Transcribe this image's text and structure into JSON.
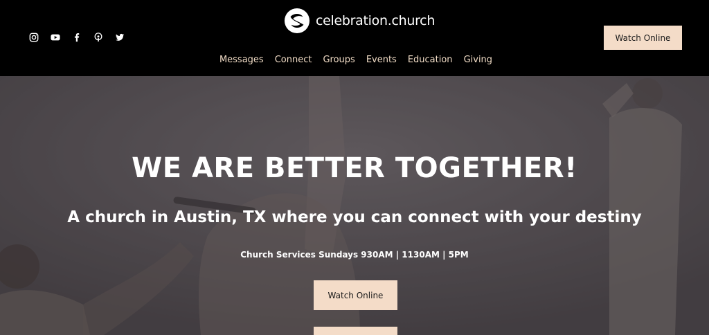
{
  "header": {
    "social_icons": [
      "instagram-icon",
      "youtube-icon",
      "facebook-icon",
      "podcast-icon",
      "twitter-icon"
    ],
    "logo_text": "celebration.church",
    "nav": [
      "Messages",
      "Connect",
      "Groups",
      "Events",
      "Education",
      "Giving"
    ],
    "cta_label": "Watch Online"
  },
  "hero": {
    "title": "WE ARE BETTER TOGETHER!",
    "subtitle": "A church in Austin, TX where you can connect with your destiny",
    "service_times": "Church Services Sundays 930AM | 1130AM | 5PM",
    "cta_label": "Watch Online"
  },
  "colors": {
    "accent": "#f4dcc8",
    "nav_text": "#f1dcc6",
    "header_bg": "#000000"
  }
}
